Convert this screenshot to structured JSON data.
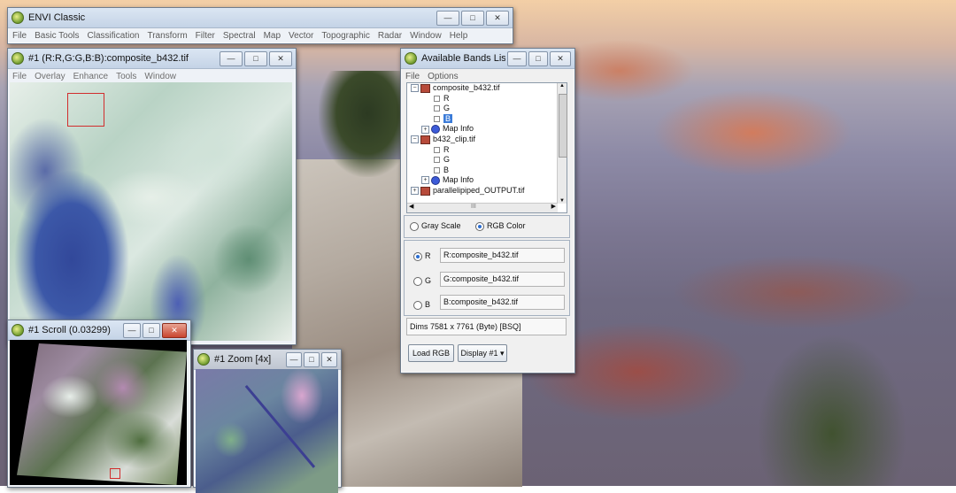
{
  "envi_main": {
    "title": "ENVI Classic",
    "menu": [
      "File",
      "Basic Tools",
      "Classification",
      "Transform",
      "Filter",
      "Spectral",
      "Map",
      "Vector",
      "Topographic",
      "Radar",
      "Window",
      "Help"
    ]
  },
  "image_window": {
    "title": "#1 (R:R,G:G,B:B):composite_b432.tif",
    "menu": [
      "File",
      "Overlay",
      "Enhance",
      "Tools",
      "Window"
    ]
  },
  "scroll_window": {
    "title": "#1 Scroll (0.03299)"
  },
  "zoom_window": {
    "title": "#1 Zoom [4x]"
  },
  "bands_list": {
    "title": "Available Bands List",
    "menu": [
      "File",
      "Options"
    ],
    "tree": [
      {
        "label": "composite_b432.tif"
      },
      {
        "label": "R"
      },
      {
        "label": "G"
      },
      {
        "label": "B"
      },
      {
        "label": "Map Info"
      },
      {
        "label": "b432_clip.tif"
      },
      {
        "label": "R"
      },
      {
        "label": "G"
      },
      {
        "label": "B"
      },
      {
        "label": "Map Info"
      },
      {
        "label": "parallelipiped_OUTPUT.tif"
      }
    ],
    "hscroll_label": "III",
    "mode_gray": "Gray Scale",
    "mode_rgb": "RGB Color",
    "channel_r_label": "R",
    "channel_g_label": "G",
    "channel_b_label": "B",
    "channel_r_value": "R:composite_b432.tif",
    "channel_g_value": "G:composite_b432.tif",
    "channel_b_value": "B:composite_b432.tif",
    "dims": "Dims  7581 x 7761 (Byte) [BSQ]",
    "load_button": "Load RGB",
    "display_button": "Display #1"
  }
}
